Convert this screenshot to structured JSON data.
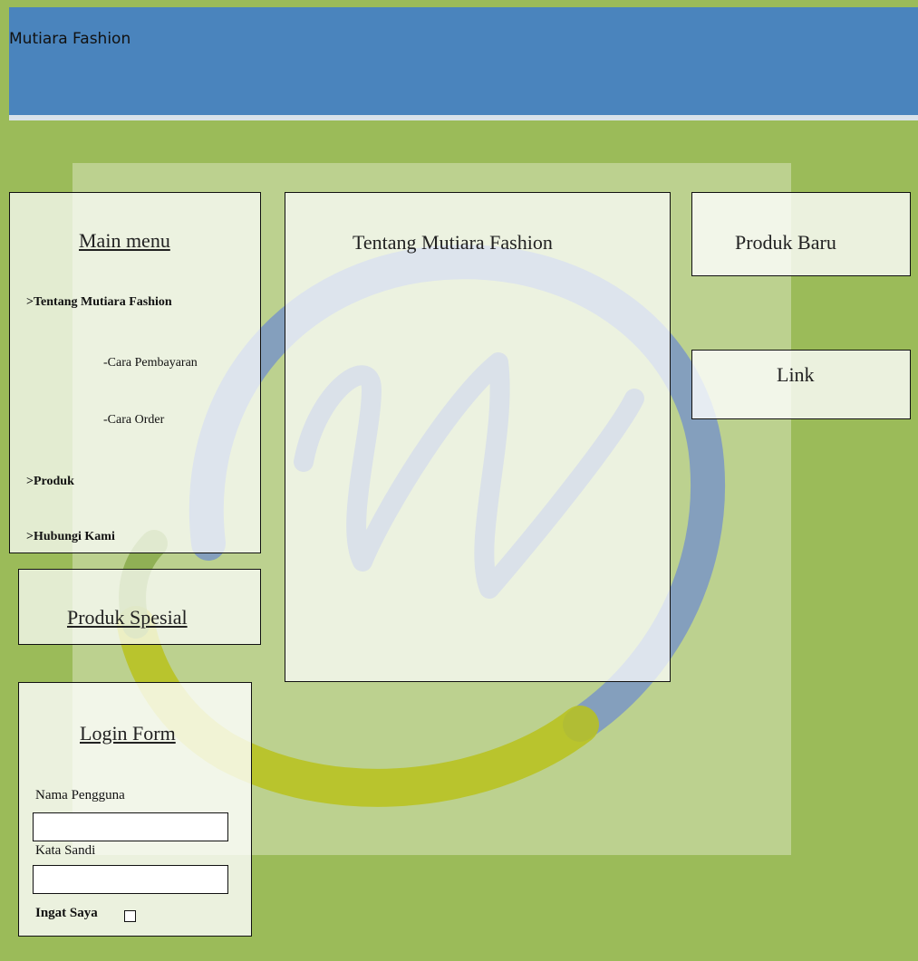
{
  "header": {
    "title": "Mutiara Fashion"
  },
  "main_menu": {
    "title": "Main menu",
    "items": [
      {
        "label": ">Tentang Mutiara Fashion"
      },
      {
        "label": "-Cara Pembayaran"
      },
      {
        "label": "-Cara Order"
      },
      {
        "label": ">Produk"
      },
      {
        "label": ">Hubungi Kami"
      }
    ]
  },
  "special_products": {
    "title": "Produk Spesial"
  },
  "login_form": {
    "title": "Login Form",
    "username_label": "Nama Pengguna",
    "password_label": "Kata Sandi",
    "remember_label": "Ingat Saya"
  },
  "content": {
    "title": "Tentang Mutiara Fashion"
  },
  "new_products": {
    "title": "Produk Baru"
  },
  "links": {
    "title": "Link"
  },
  "colors": {
    "header": "#4a84bd",
    "background": "#9bbb59",
    "header_line": "#d9e2ea"
  },
  "watermark": {
    "icon": "w-logo-icon"
  }
}
